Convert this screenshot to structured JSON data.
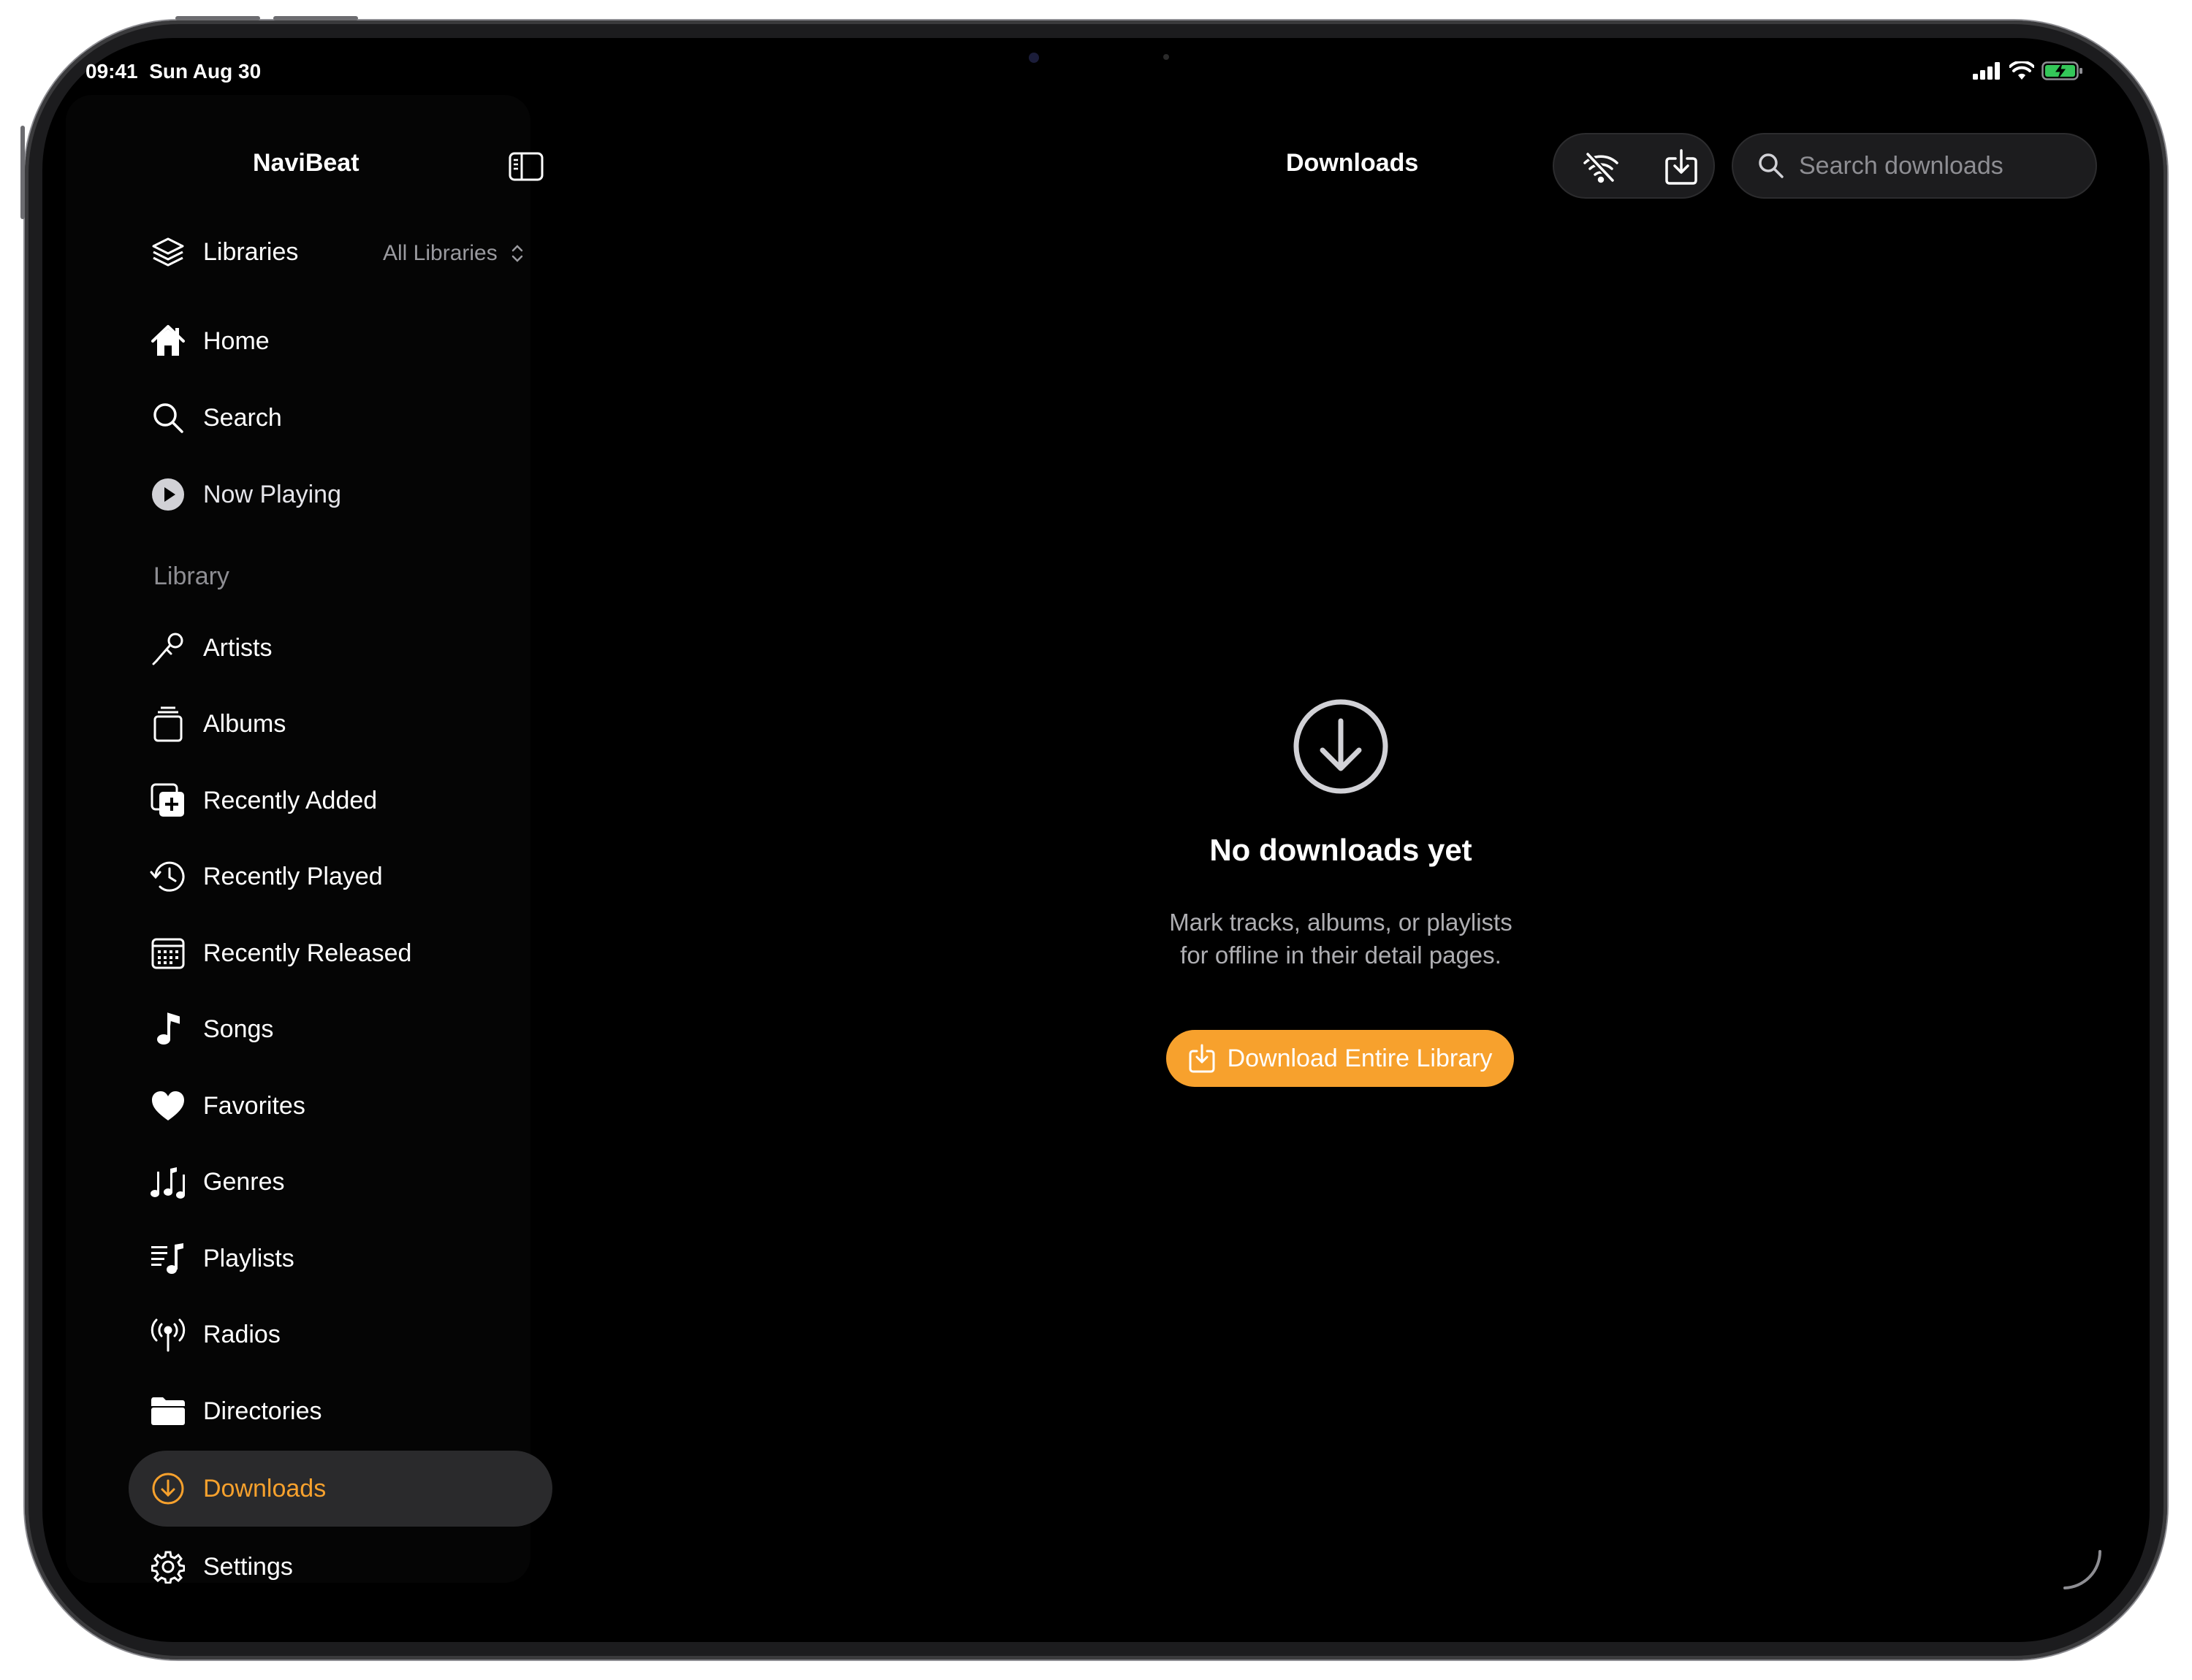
{
  "status_bar": {
    "time": "09:41",
    "date": "Sun Aug 30"
  },
  "sidebar": {
    "app_title": "NaviBeat",
    "libraries": {
      "label": "Libraries",
      "selector_value": "All Libraries"
    },
    "nav_items": [
      {
        "label": "Home",
        "icon": "house-icon"
      },
      {
        "label": "Search",
        "icon": "magnifier-icon"
      },
      {
        "label": "Now Playing",
        "icon": "play-circle-icon"
      }
    ],
    "library_section": {
      "title": "Library",
      "items": [
        {
          "label": "Artists",
          "icon": "microphone-icon"
        },
        {
          "label": "Albums",
          "icon": "album-stack-icon"
        },
        {
          "label": "Recently Added",
          "icon": "recently-added-icon"
        },
        {
          "label": "Recently Played",
          "icon": "history-icon"
        },
        {
          "label": "Recently Released",
          "icon": "calendar-icon"
        },
        {
          "label": "Songs",
          "icon": "music-note-icon"
        },
        {
          "label": "Favorites",
          "icon": "heart-icon"
        },
        {
          "label": "Genres",
          "icon": "music-notes-icon"
        },
        {
          "label": "Playlists",
          "icon": "playlist-icon"
        },
        {
          "label": "Radios",
          "icon": "antenna-icon"
        },
        {
          "label": "Directories",
          "icon": "folder-icon"
        },
        {
          "label": "Downloads",
          "icon": "download-circle-icon",
          "selected": true
        },
        {
          "label": "Settings",
          "icon": "gear-icon"
        }
      ]
    }
  },
  "main": {
    "title": "Downloads",
    "search": {
      "placeholder": "Search downloads"
    },
    "empty_state": {
      "title": "No downloads yet",
      "description_line1": "Mark tracks, albums, or playlists",
      "description_line2": "for offline in their detail pages.",
      "button_label": "Download Entire Library"
    }
  },
  "colors": {
    "accent": "#f7a12d",
    "background": "#000000",
    "selected_row": "#2a2a2c",
    "battery": "#34c759"
  }
}
